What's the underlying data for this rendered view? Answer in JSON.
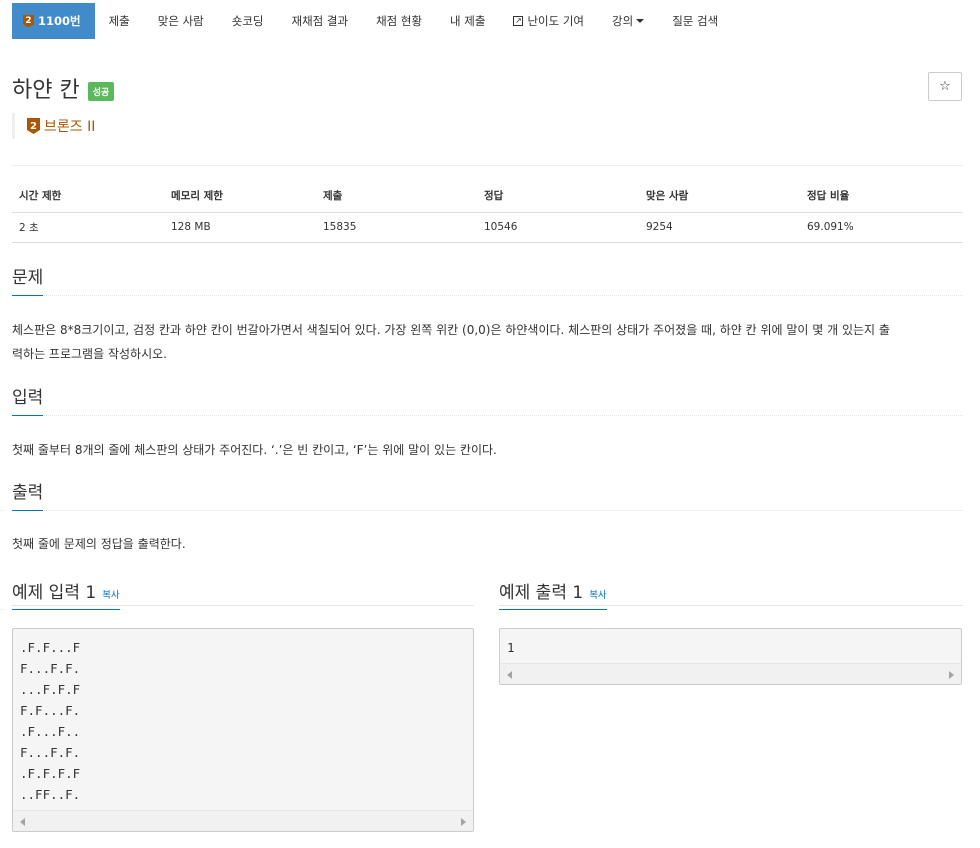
{
  "nav": {
    "tabs": [
      {
        "label": "1100번",
        "medal": "2"
      },
      {
        "label": "제출"
      },
      {
        "label": "맞은 사람"
      },
      {
        "label": "숏코딩"
      },
      {
        "label": "재채점 결과"
      },
      {
        "label": "채점 현황"
      },
      {
        "label": "내 제출"
      },
      {
        "label": "난이도 기여",
        "icon": "external-link-icon"
      },
      {
        "label": "강의",
        "icon": "caret-down-icon"
      },
      {
        "label": "질문 검색"
      }
    ]
  },
  "problem": {
    "title": "하얀 칸",
    "status_badge": "성공",
    "star": "☆",
    "tier_medal": "2",
    "tier_label": "브론즈 II",
    "tier_color": "#ad5600"
  },
  "stats": {
    "headers": [
      "시간 제한",
      "메모리 제한",
      "제출",
      "정답",
      "맞은 사람",
      "정답 비율"
    ],
    "values": [
      "2 초",
      "128 MB",
      "15835",
      "10546",
      "9254",
      "69.091%"
    ]
  },
  "sections": {
    "description": {
      "heading": "문제",
      "line1": "체스판은 8*8크기이고, 검정 칸과 하얀 칸이 번갈아가면서 색칠되어 있다. 가장 왼쪽 위칸 (0,0)은 하얀색이다. 체스판의 상태가 주어졌을 때, 하얀 칸 위에 말이 몇 개 있는지 출",
      "line2": "력하는 프로그램을 작성하시오."
    },
    "input": {
      "heading": "입력",
      "text": "첫째 줄부터 8개의 줄에 체스판의 상태가 주어진다. ‘.’은 빈 칸이고, ‘F’는 위에 말이 있는 칸이다."
    },
    "output": {
      "heading": "출력",
      "text": "첫째 줄에 문제의 정답을 출력한다."
    }
  },
  "samples": {
    "input_title": "예제 입력 1",
    "output_title": "예제 출력 1",
    "copy_label": "복사",
    "input_lines": [
      ".F.F...F",
      "F...F.F.",
      "...F.F.F",
      "F.F...F.",
      ".F...F..",
      "F...F.F.",
      ".F.F.F.F",
      "..FF..F."
    ],
    "output_lines": [
      "1"
    ]
  },
  "colors": {
    "accent": "#428bca",
    "success": "#5cb85c",
    "link": "#0076c0"
  }
}
